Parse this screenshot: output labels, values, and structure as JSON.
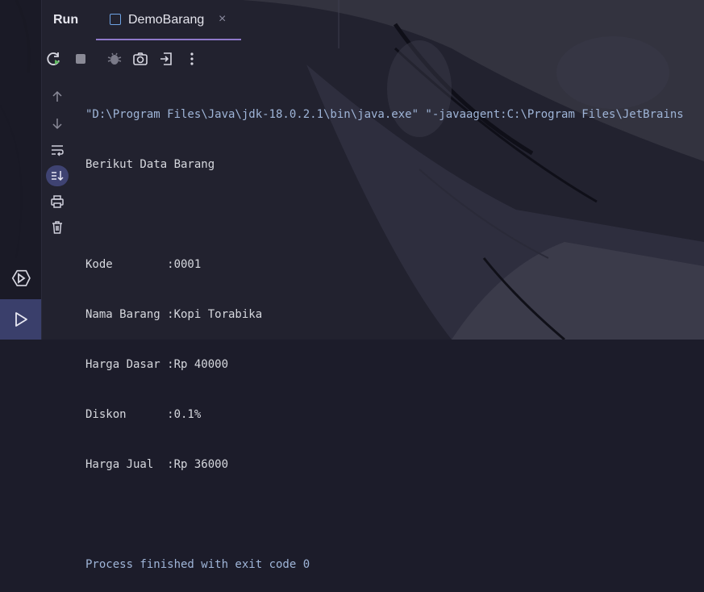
{
  "header": {
    "run_label": "Run",
    "tab_label": "DemoBarang",
    "tab_close": "×"
  },
  "icons": {
    "toolbar": [
      "rerun-icon",
      "stop-icon",
      "debug-icon",
      "screenshot-icon",
      "exit-icon",
      "more-icon"
    ],
    "gutter": [
      "scroll-up-icon",
      "scroll-down-icon",
      "soft-wrap-icon",
      "scroll-to-end-icon",
      "print-icon",
      "clear-icon"
    ],
    "left_strip": [
      "services-icon",
      "run-icon"
    ]
  },
  "console": {
    "lines": [
      "\"D:\\Program Files\\Java\\jdk-18.0.2.1\\bin\\java.exe\" \"-javaagent:C:\\Program Files\\JetBrains",
      "Berikut Data Barang",
      "",
      "Kode        :0001",
      "Nama Barang :Kopi Torabika",
      "Harga Dasar :Rp 40000",
      "Diskon      :0.1%",
      "Harga Jual  :Rp 36000",
      "",
      "Process finished with exit code 0"
    ]
  },
  "colors": {
    "accent": "#8e78c9",
    "active_strip": "#3a3f6b",
    "console_text": "#d6d8de",
    "command_text": "#9fb5d8"
  }
}
